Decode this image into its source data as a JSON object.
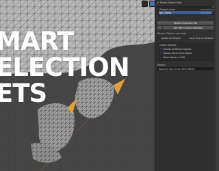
{
  "overlay": {
    "line1": "MART",
    "line2": "ELECTION",
    "line3": "ETS"
  },
  "panel": {
    "header": "Smart Select Sets",
    "sets": [
      {
        "name": "Dragons_Head",
        "extra": "EDIT_MESH"
      },
      {
        "name": "Nail_Points",
        "extra": "EDIT_MESH"
      }
    ],
    "restore_button": "Restore Selection Set",
    "diff_button": "Diff With Current Selection",
    "restore_options_label": "Restore Options (per set):",
    "opt_isolate": "Isolate on Restore",
    "opt_local_view": "Local View on Restore",
    "global_options_label": "Global Options:",
    "opt_include_all": "Include All Before Restore",
    "opt_restore_mesh_mode": "Restore Mesh Select Mode",
    "opt_show_names": "Show Names In Diff",
    "report_label": "Report:",
    "report_value": "Restored 'Nail_Points' (EDIT_MESH)"
  },
  "colors": {
    "accent": "#4772b3",
    "panel_bg": "#303030",
    "active_row": "#3f5f8c",
    "horn": "#e0a13c"
  }
}
